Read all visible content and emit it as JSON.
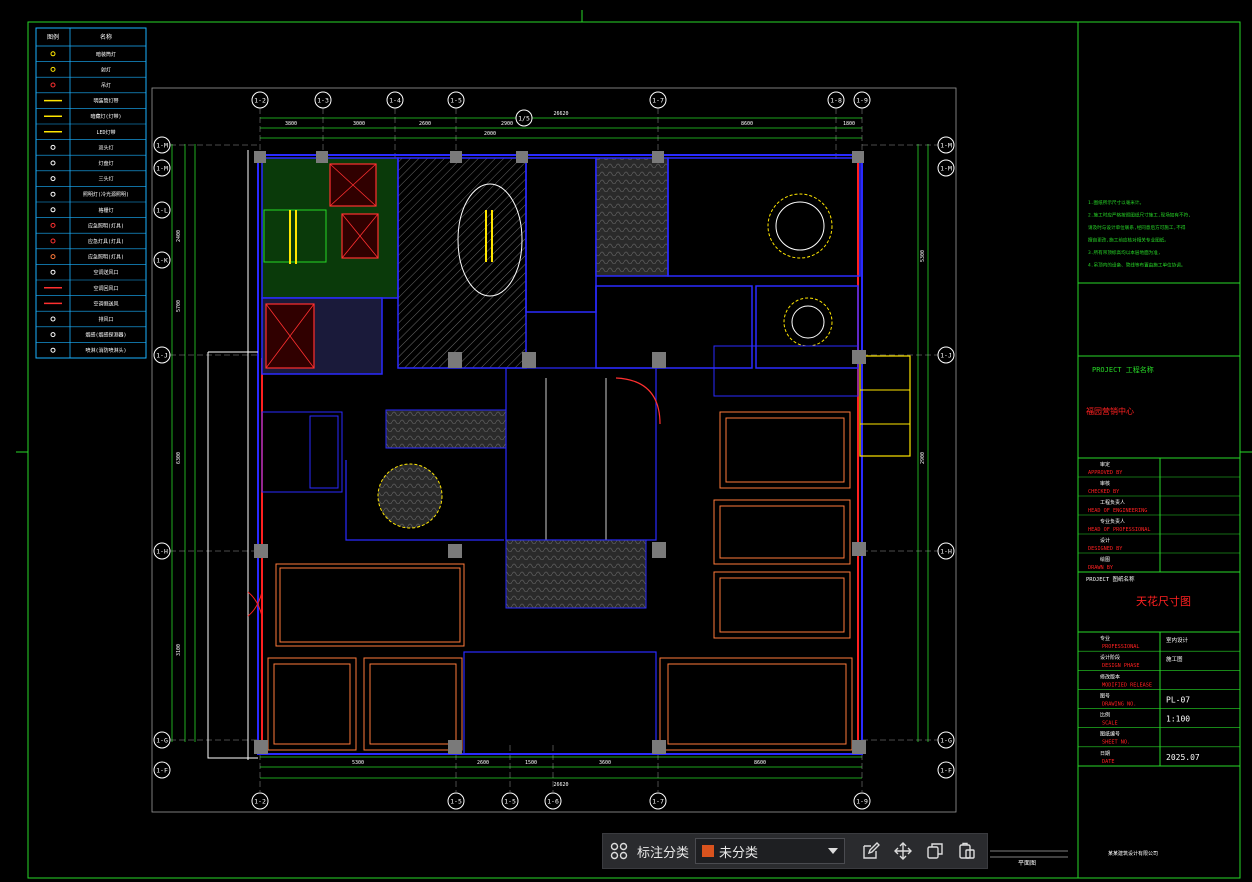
{
  "legend": {
    "header": [
      "图例",
      "名称"
    ],
    "rows": [
      "暗装筒灯",
      "射灯",
      "吊灯",
      "明装筒灯带",
      "暗藏灯(灯带)",
      "LED灯带",
      "双头灯",
      "灯盘灯",
      "三头灯",
      "照明灯(冷光源照明)",
      "格栅灯",
      "应急照明(灯具)",
      "应急灯具(灯具)",
      "应急照明(灯具)",
      "空调送风口",
      "空调回风口",
      "空调侧送风",
      "排风口",
      "烟感(烟感探测器)",
      "喷淋(消防喷淋头)"
    ]
  },
  "grid_axes": {
    "top": [
      "1-2",
      "1-3",
      "1-4",
      "1-5",
      "1-7",
      "1-8",
      "1-9"
    ],
    "bottom": [
      "1-2",
      "1-5",
      "1-5",
      "1-6",
      "1-7",
      "1-9"
    ],
    "left": [
      "1-M",
      "1-M",
      "1-L",
      "1-K",
      "1-J",
      "1-H",
      "1-G",
      "1-F"
    ],
    "right": [
      "1-M",
      "1-M",
      "1-J",
      "1-H",
      "1-G",
      "1-F"
    ],
    "mid_label": "1/5"
  },
  "dimensions": {
    "top_total": "26620",
    "top": [
      "3800",
      "3000",
      "2600",
      "2900",
      "8600",
      "1800"
    ],
    "top_small": "2000",
    "bottom_total": "26620",
    "bottom": [
      "5300",
      "2600",
      "1500",
      "3600",
      "8600"
    ],
    "left": [
      "2400",
      "5700",
      "6300",
      "3100"
    ],
    "right": [
      "5300",
      "2900"
    ]
  },
  "title_block": {
    "notes": [
      "1.图纸所示尺寸以毫米计。",
      "2.施工时应严格按照图纸尺寸施工,现场如有不符,",
      "  请及时与设计单位联系,经同意后方可施工,不得",
      "  擅自更改,施工前应核对相关专业图纸。",
      "3.所有吊顶标高均以本层地面为准,",
      "4.吊顶内的设备、管线等布置由施工单位协调。"
    ],
    "project_label": "PROJECT  工程名称",
    "project_name": "福园营销中心",
    "approved_cn": "审定",
    "approved": "APPROVED BY",
    "checked_cn": "审核",
    "checked": "CHECKED BY",
    "head_eng_cn": "工程负责人",
    "head_eng": "HEAD OF ENGINEERING",
    "head_prof_cn": "专业负责人",
    "head_prof": "HEAD OF PROFESSIONAL",
    "designed_cn": "设计",
    "designed": "DESIGNED BY",
    "drawn_cn": "绘图",
    "drawn": "DRAWN BY",
    "drawing_label": "PROJECT  图纸名称",
    "drawing_name": "天花尺寸图",
    "professional_cn": "专业",
    "professional": "PROFESSIONAL",
    "professional_val": "室内设计",
    "phase_cn": "设计阶段",
    "phase": "DESIGN PHASE",
    "phase_val": "施工图",
    "release_cn": "修改版本",
    "release": "MODIFIED RELEASE",
    "drawing_no_cn": "图号",
    "drawing_no": "DRAWING NO.",
    "drawing_no_val": "PL-07",
    "scale_cn": "比例",
    "scale": "SCALE",
    "scale_val": "1:100",
    "sheet_cn": "图纸编号",
    "sheet": "SHEET NO.",
    "date_cn": "日期",
    "date": "DATE",
    "date_val": "2025.07",
    "footer": "某某建筑设计有限公司"
  },
  "bottom_note": "平面图",
  "toolbar": {
    "label": "标注分类",
    "selected": "未分类",
    "swatch_color": "#d9531e"
  }
}
